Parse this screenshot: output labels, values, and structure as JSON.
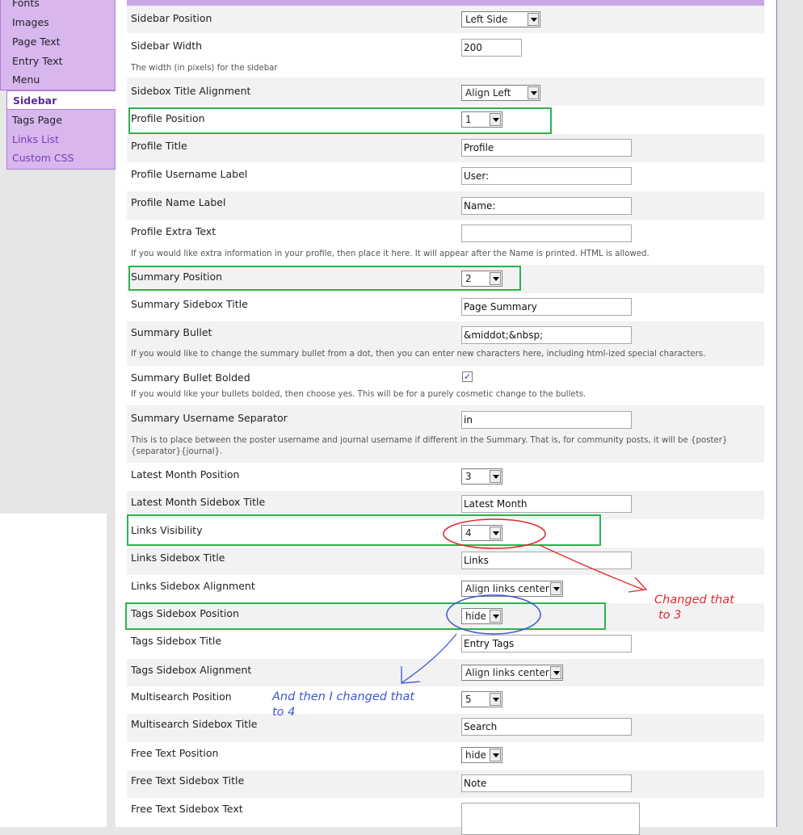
{
  "nav": {
    "group1": [
      {
        "label": "Fonts"
      },
      {
        "label": "Images"
      },
      {
        "label": "Page Text"
      },
      {
        "label": "Entry Text"
      },
      {
        "label": "Menu"
      }
    ],
    "active": {
      "label": "Sidebar"
    },
    "group2": [
      {
        "label": "Tags Page"
      },
      {
        "label": "Links List"
      },
      {
        "label": "Custom CSS"
      }
    ]
  },
  "settings": {
    "sidebar_position": {
      "label": "Sidebar Position",
      "value": "Left Side"
    },
    "sidebar_width": {
      "label": "Sidebar Width",
      "value": "200",
      "desc": "The width (in pixels) for the sidebar"
    },
    "sidebox_title_alignment": {
      "label": "Sidebox Title Alignment",
      "value": "Align Left"
    },
    "profile_position": {
      "label": "Profile Position",
      "value": "1"
    },
    "profile_title": {
      "label": "Profile Title",
      "value": "Profile"
    },
    "profile_username_label": {
      "label": "Profile Username Label",
      "value": "User:"
    },
    "profile_name_label": {
      "label": "Profile Name Label",
      "value": "Name:"
    },
    "profile_extra_text": {
      "label": "Profile Extra Text",
      "value": "",
      "desc": "If you would like extra information in your profile, then place it here. It will appear after the Name is printed. HTML is allowed."
    },
    "summary_position": {
      "label": "Summary Position",
      "value": "2"
    },
    "summary_sidebox_title": {
      "label": "Summary Sidebox Title",
      "value": "Page Summary"
    },
    "summary_bullet": {
      "label": "Summary Bullet",
      "value": "&middot;&nbsp;",
      "desc": "If you would like to change the summary bullet from a dot, then you can enter new characters here, including html-ized special characters."
    },
    "summary_bullet_bolded": {
      "label": "Summary Bullet Bolded",
      "checked_glyph": "✓",
      "desc": "If you would like your bullets bolded, then choose yes. This will be for a purely cosmetic change to the bullets."
    },
    "summary_username_separator": {
      "label": "Summary Username Separator",
      "value": "in",
      "desc": "This is to place between the poster username and journal username if different in the Summary. That is, for community posts, it will be {poster}{separator}{journal}."
    },
    "latest_month_position": {
      "label": "Latest Month Position",
      "value": "3"
    },
    "latest_month_sidebox_title": {
      "label": "Latest Month Sidebox Title",
      "value": "Latest Month"
    },
    "links_visibility": {
      "label": "Links Visibility",
      "value": "4"
    },
    "links_sidebox_title": {
      "label": "Links Sidebox Title",
      "value": "Links"
    },
    "links_sidebox_alignment": {
      "label": "Links Sidebox Alignment",
      "value": "Align links center"
    },
    "tags_sidebox_position": {
      "label": "Tags Sidebox Position",
      "value": "hide"
    },
    "tags_sidebox_title": {
      "label": "Tags Sidebox Title",
      "value": "Entry Tags"
    },
    "tags_sidebox_alignment": {
      "label": "Tags Sidebox Alignment",
      "value": "Align links center"
    },
    "multisearch_position": {
      "label": "Multisearch Position",
      "value": "5"
    },
    "multisearch_sidebox_title": {
      "label": "Multisearch Sidebox Title",
      "value": "Search"
    },
    "free_text_position": {
      "label": "Free Text Position",
      "value": "hide"
    },
    "free_text_sidebox_title": {
      "label": "Free Text Sidebox Title",
      "value": "Note"
    },
    "free_text_sidebox_text": {
      "label": "Free Text Sidebox Text",
      "value": ""
    }
  },
  "annotations": {
    "red_note_line1": "Changed that",
    "red_note_line2": "to 3",
    "blue_note_line1": "And then I changed that",
    "blue_note_line2": "to 4",
    "red_color": "#e0282c",
    "blue_color": "#3b56d6",
    "green_color": "#2db44b"
  }
}
